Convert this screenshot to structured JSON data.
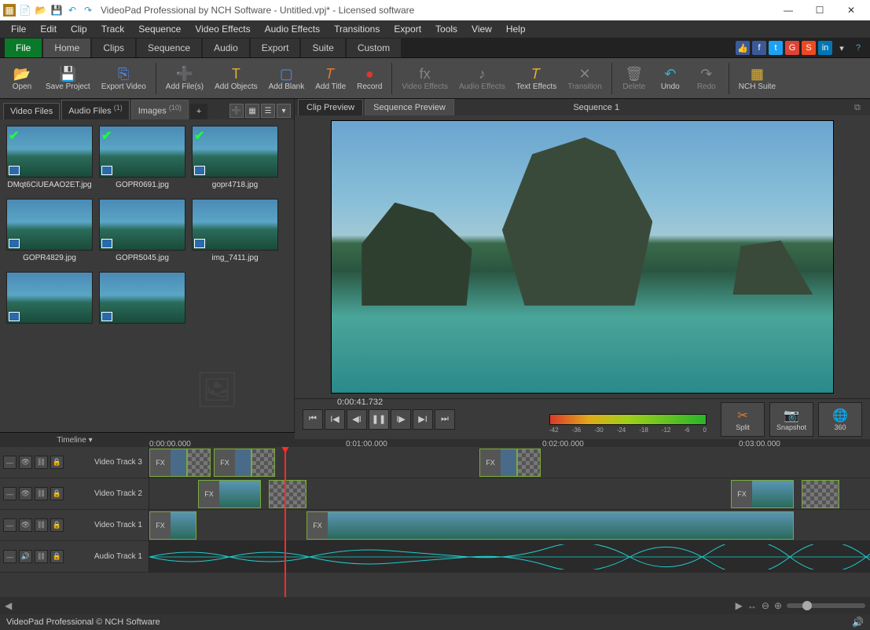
{
  "window": {
    "title": "VideoPad Professional by NCH Software - Untitled.vpj* - Licensed software"
  },
  "menubar": [
    "File",
    "Edit",
    "Clip",
    "Track",
    "Sequence",
    "Video Effects",
    "Audio Effects",
    "Transitions",
    "Export",
    "Tools",
    "View",
    "Help"
  ],
  "ribbon_tabs": {
    "file": "File",
    "items": [
      "Home",
      "Clips",
      "Sequence",
      "Audio",
      "Export",
      "Suite",
      "Custom"
    ],
    "active": "Home"
  },
  "ribbon": {
    "open": "Open",
    "save": "Save Project",
    "export": "Export Video",
    "addfiles": "Add File(s)",
    "addobjects": "Add Objects",
    "addblank": "Add Blank",
    "addtitle": "Add Title",
    "record": "Record",
    "videofx": "Video Effects",
    "audiofx": "Audio Effects",
    "textfx": "Text Effects",
    "transition": "Transition",
    "delete": "Delete",
    "undo": "Undo",
    "redo": "Redo",
    "suite": "NCH Suite"
  },
  "bin": {
    "tabs": {
      "video": {
        "label": "Video Files",
        "count": ""
      },
      "audio": {
        "label": "Audio Files",
        "count": "(1)"
      },
      "images": {
        "label": "Images",
        "count": "(10)"
      }
    },
    "items": [
      {
        "name": "DMqt6CiUEAAO2ET.jpg",
        "checked": true
      },
      {
        "name": "GOPR0691.jpg",
        "checked": true
      },
      {
        "name": "gopr4718.jpg",
        "checked": true
      },
      {
        "name": "GOPR4829.jpg",
        "checked": false
      },
      {
        "name": "GOPR5045.jpg",
        "checked": false
      },
      {
        "name": "img_7411.jpg",
        "checked": false
      },
      {
        "name": "",
        "checked": false
      },
      {
        "name": "",
        "checked": false
      }
    ]
  },
  "preview": {
    "tab_clip": "Clip Preview",
    "tab_seq": "Sequence Preview",
    "sequence_name": "Sequence 1",
    "timecode": "0:00:41.732",
    "vu_labels": [
      "-42",
      "-36",
      "-30",
      "-24",
      "-18",
      "-12",
      "-6",
      "0"
    ],
    "split": "Split",
    "snapshot": "Snapshot",
    "threesixty": "360"
  },
  "timeline": {
    "label": "Timeline",
    "marks": {
      "m0": "0:00:00.000",
      "m1": "0:01:00.000",
      "m2": "0:02:00.000",
      "m3": "0:03:00.000"
    },
    "tracks": {
      "v3": "Video Track 3",
      "v2": "Video Track 2",
      "v1": "Video Track 1",
      "a1": "Audio Track 1"
    },
    "fx_label": "FX"
  },
  "status": {
    "text": "VideoPad Professional © NCH Software"
  }
}
